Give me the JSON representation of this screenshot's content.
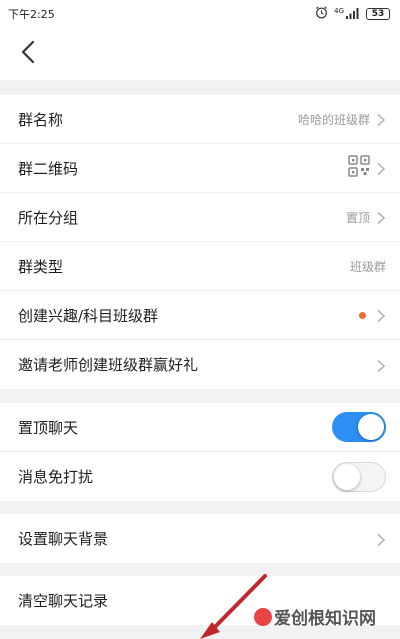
{
  "status_bar": {
    "time": "下午2:25",
    "network": "4G",
    "battery": "53",
    "icons": [
      "alarm-icon",
      "signal-icon",
      "battery-icon"
    ]
  },
  "nav": {
    "back_icon": "back-arrow-icon"
  },
  "group_info": [
    {
      "label": "群名称",
      "value": "哈哈的班级群",
      "chevron": true
    },
    {
      "label": "群二维码",
      "value": "",
      "icon": "qr-code-icon",
      "chevron": true
    },
    {
      "label": "所在分组",
      "value": "置顶",
      "chevron": true
    },
    {
      "label": "群类型",
      "value": "班级群",
      "chevron": false
    },
    {
      "label": "创建兴趣/科目班级群",
      "value": "",
      "badge_dot": true,
      "chevron": true
    },
    {
      "label": "邀请老师创建班级群赢好礼",
      "value": "",
      "chevron": true
    }
  ],
  "toggles": [
    {
      "label": "置顶聊天",
      "state": "on"
    },
    {
      "label": "消息免打扰",
      "state": "off"
    }
  ],
  "background_row": {
    "label": "设置聊天背景"
  },
  "clear_row": {
    "label": "清空聊天记录"
  },
  "watermark": {
    "text": "爱创根知识网"
  },
  "colors": {
    "accent": "#2d8ef4",
    "badge_dot": "#ef6b2b",
    "annotation_arrow": "#c0282d",
    "page_bg": "#f2f2f4"
  }
}
